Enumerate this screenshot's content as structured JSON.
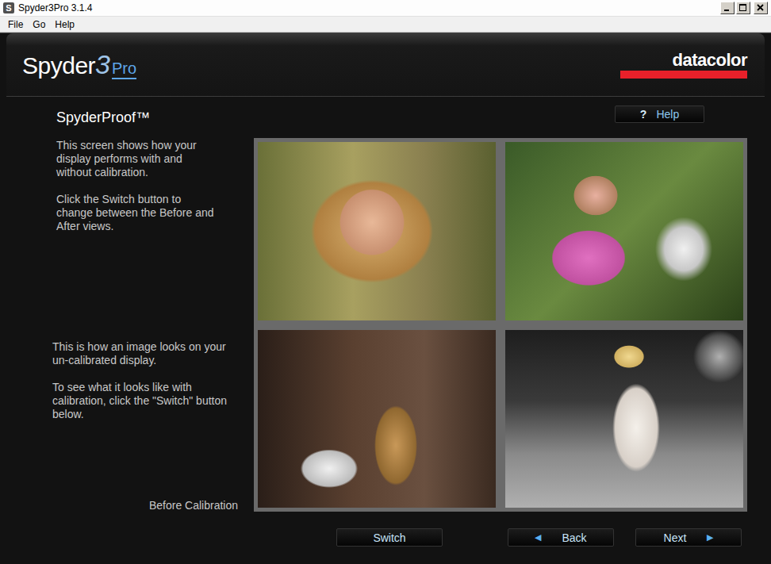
{
  "window": {
    "title": "Spyder3Pro 3.1.4",
    "icon": "S"
  },
  "menu": [
    "File",
    "Go",
    "Help"
  ],
  "logo": {
    "brand": "Spyder",
    "model": "3",
    "edition": "Pro"
  },
  "vendor": "datacolor",
  "help_button": {
    "icon": "?",
    "label": "Help"
  },
  "page": {
    "title": "SpyderProof™",
    "intro": [
      "This screen shows how your display performs with and without calibration.",
      "Click the Switch button to change between the Before and After views."
    ],
    "status": [
      "This is how an image looks on your un-calibrated display.",
      "To see what it looks like with calibration, click the \"Switch\" button below."
    ],
    "mode": "Before Calibration"
  },
  "photos": [
    {
      "kind": "portrait"
    },
    {
      "kind": "child"
    },
    {
      "kind": "musician"
    },
    {
      "kind": "performer"
    }
  ],
  "buttons": [
    {
      "label": "Switch",
      "icon": ""
    },
    {
      "label": "Back",
      "icon": "◀"
    },
    {
      "label": "Next",
      "icon": "▶"
    }
  ]
}
